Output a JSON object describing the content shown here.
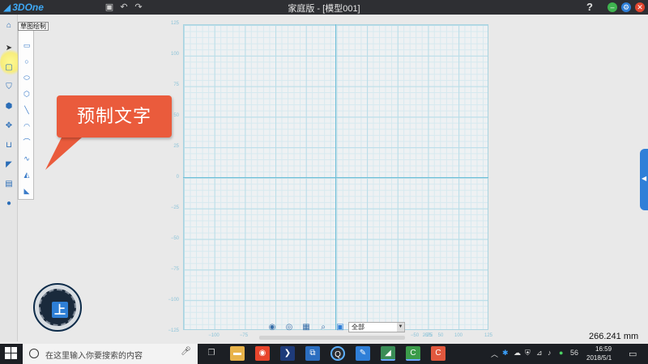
{
  "app": {
    "name": "3DOne",
    "window_title": "家庭版 - [模型001]"
  },
  "titlebar": {
    "help_label": "?",
    "minimize_label": "–",
    "settings_label": "⚙",
    "close_label": "✕"
  },
  "sketch_panel": {
    "tooltip": "草图绘制"
  },
  "callout": {
    "text": "预制文字"
  },
  "view_cube": {
    "face_label": "上"
  },
  "grid": {
    "y_ticks": [
      "125",
      "100",
      "75",
      "50",
      "25",
      "0",
      "−25",
      "−50",
      "−75",
      "−100",
      "−125"
    ],
    "x_ticks": [
      "−100",
      "−75",
      "−50",
      "−25",
      "25",
      "50",
      "75",
      "100",
      "125"
    ]
  },
  "view_toolbar": {
    "selected_view": "全部"
  },
  "status": {
    "unit_readout": "266.241 mm"
  },
  "taskbar": {
    "search_placeholder": "在这里输入你要搜索的内容",
    "clock_time": "16:59",
    "clock_date": "2018/5/1",
    "tray_number": "56"
  }
}
